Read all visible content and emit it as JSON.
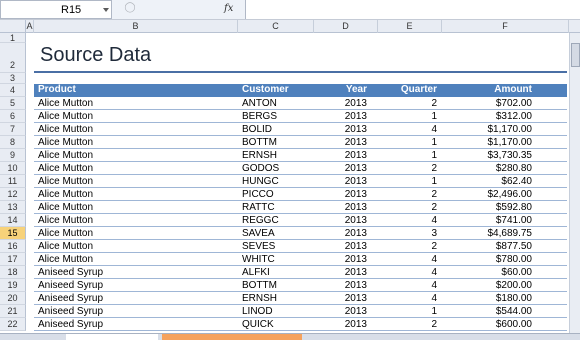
{
  "formula_bar": {
    "name_box": "R15",
    "fx": "fx"
  },
  "columns": [
    "A",
    "B",
    "C",
    "D",
    "E",
    "F"
  ],
  "rows": [
    "1",
    "2",
    "3",
    "4",
    "5",
    "6",
    "7",
    "8",
    "9",
    "10",
    "11",
    "12",
    "13",
    "14",
    "15",
    "16",
    "17",
    "18",
    "19",
    "20",
    "21",
    "22"
  ],
  "selected_row": "15",
  "title": "Source Data",
  "table": {
    "headers": {
      "product": "Product",
      "customer": "Customer",
      "year": "Year",
      "quarter": "Quarter",
      "amount": "Amount"
    },
    "rows": [
      [
        "Alice Mutton",
        "ANTON",
        "2013",
        "2",
        "$702.00"
      ],
      [
        "Alice Mutton",
        "BERGS",
        "2013",
        "1",
        "$312.00"
      ],
      [
        "Alice Mutton",
        "BOLID",
        "2013",
        "4",
        "$1,170.00"
      ],
      [
        "Alice Mutton",
        "BOTTM",
        "2013",
        "1",
        "$1,170.00"
      ],
      [
        "Alice Mutton",
        "ERNSH",
        "2013",
        "1",
        "$3,730.35"
      ],
      [
        "Alice Mutton",
        "GODOS",
        "2013",
        "2",
        "$280.80"
      ],
      [
        "Alice Mutton",
        "HUNGC",
        "2013",
        "1",
        "$62.40"
      ],
      [
        "Alice Mutton",
        "PICCO",
        "2013",
        "2",
        "$2,496.00"
      ],
      [
        "Alice Mutton",
        "RATTC",
        "2013",
        "2",
        "$592.80"
      ],
      [
        "Alice Mutton",
        "REGGC",
        "2013",
        "4",
        "$741.00"
      ],
      [
        "Alice Mutton",
        "SAVEA",
        "2013",
        "3",
        "$4,689.75"
      ],
      [
        "Alice Mutton",
        "SEVES",
        "2013",
        "2",
        "$877.50"
      ],
      [
        "Alice Mutton",
        "WHITC",
        "2013",
        "4",
        "$780.00"
      ],
      [
        "Aniseed Syrup",
        "ALFKI",
        "2013",
        "4",
        "$60.00"
      ],
      [
        "Aniseed Syrup",
        "BOTTM",
        "2013",
        "4",
        "$200.00"
      ],
      [
        "Aniseed Syrup",
        "ERNSH",
        "2013",
        "4",
        "$180.00"
      ],
      [
        "Aniseed Syrup",
        "LINOD",
        "2013",
        "1",
        "$544.00"
      ],
      [
        "Aniseed Syrup",
        "QUICK",
        "2013",
        "2",
        "$600.00"
      ]
    ]
  }
}
